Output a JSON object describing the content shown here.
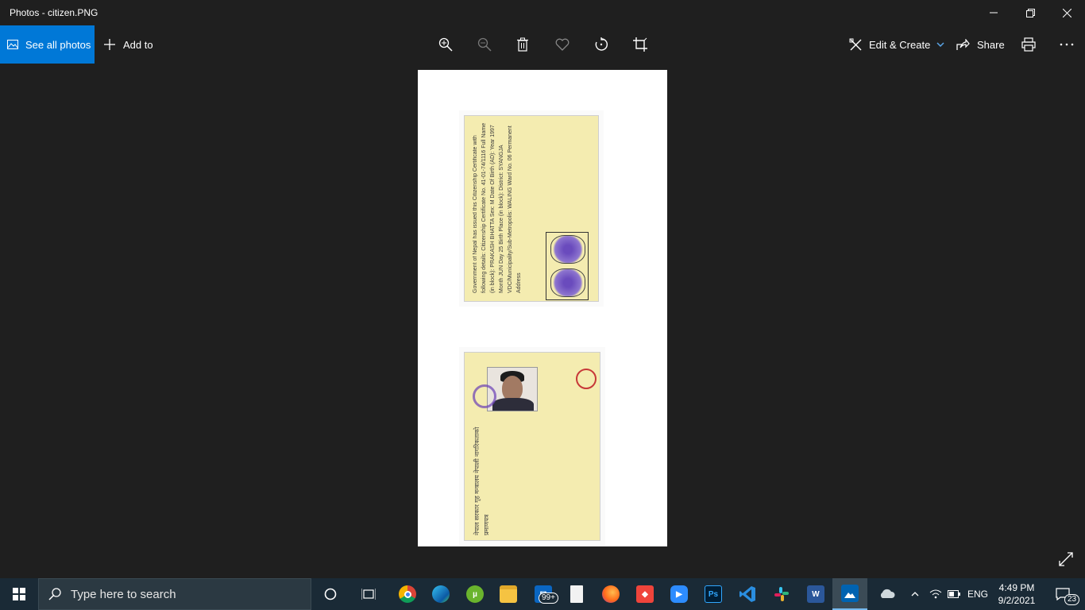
{
  "window": {
    "title": "Photos - citizen.PNG",
    "controls": [
      "minimize",
      "restore",
      "close"
    ]
  },
  "toolbar": {
    "see_all_label": "See all photos",
    "add_to_label": "Add to",
    "edit_create_label": "Edit & Create",
    "share_label": "Share",
    "icons": [
      "zoom-in-icon",
      "zoom-out-icon",
      "delete-icon",
      "heart-icon",
      "rotate-icon",
      "crop-icon",
      "print-icon",
      "more-icon"
    ]
  },
  "document": {
    "front_text": "Government of Nepal has issued this Citizenship Certificate with following details: Citizenship Certificate No. 41-01-74/1116 Full Name (in block): PRAKASH BHATTA Sex: M Date Of Birth (AD): Year 1997 Month JUN Day 25 Birth Place (in block): District: SYANGJA VDC/Municipality/Sub-Metropolis: WALING Ward No. 06 Permanent Address",
    "back_text": "नेपाल सरकार गृह मन्त्रालय नेपाली नागरिकताको प्रमाणपत्र"
  },
  "taskbar": {
    "search_placeholder": "Type here to search",
    "mail_badge": "99+",
    "language": "ENG",
    "time": "4:49 PM",
    "date": "9/2/2021",
    "notifications": "23"
  },
  "colors": {
    "accent": "#0078d7",
    "background": "#1f1f1f",
    "taskbar": "#1a2a36"
  }
}
